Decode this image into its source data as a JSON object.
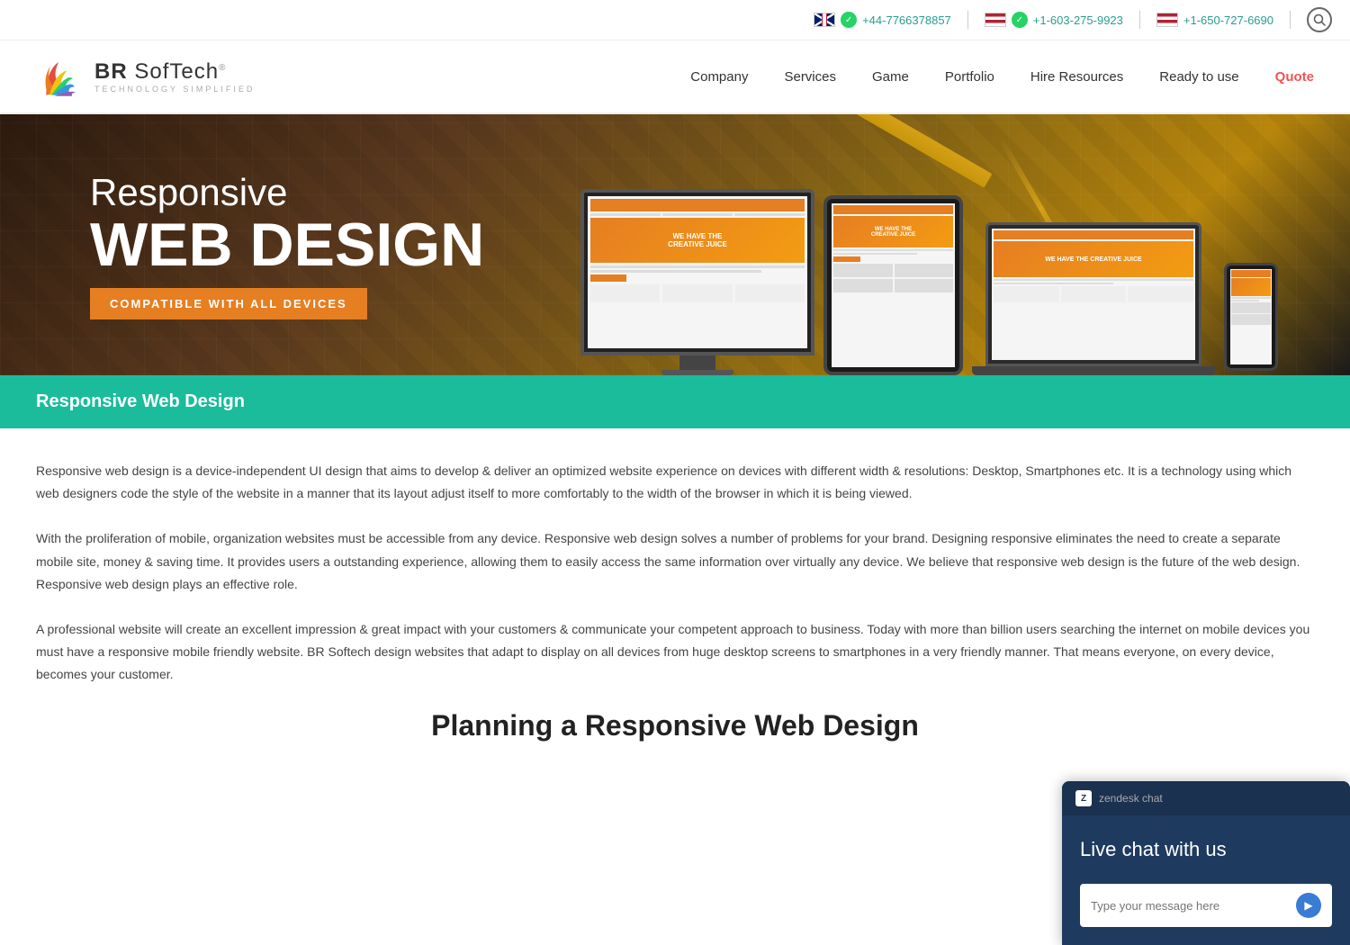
{
  "topbar": {
    "phone_uk": "+44-7766378857",
    "phone_us1": "+1-603-275-9923",
    "phone_us2": "+1-650-727-6690"
  },
  "header": {
    "brand": "BR SofTech",
    "tagline": "TECHNOLOGY SIMPLIFIED",
    "nav": {
      "company": "Company",
      "services": "Services",
      "game": "Game",
      "portfolio": "Portfolio",
      "hire_resources": "Hire Resources",
      "ready_to_use": "Ready to use",
      "quote": "Quote"
    }
  },
  "hero": {
    "line1": "Responsive",
    "line2": "WEB DESIGN",
    "badge": "COMPATIBLE WITH ALL DEVICES"
  },
  "breadcrumb": {
    "title": "Responsive Web Design"
  },
  "content": {
    "para1": "Responsive web design is a device-independent UI design that aims to develop & deliver an optimized website experience on devices with different width & resolutions: Desktop, Smartphones etc. It is a technology using which web designers code the style of the website in a manner that its layout adjust itself to more comfortably to the width of the browser in which it is being viewed.",
    "para2": "With the proliferation of mobile, organization websites must be accessible from any device. Responsive web design solves a number of problems for your brand. Designing responsive eliminates the need to create a separate mobile site, money & saving time. It provides users a outstanding experience, allowing them to easily access the same information over virtually any device. We believe that responsive web design is the future of the web design. Responsive web design plays an effective role.",
    "para3": "A professional website will create an excellent impression & great impact with your customers & communicate your competent approach to business. Today with more than billion users searching the internet on mobile devices you must have a responsive mobile friendly website. BR Softech design websites that adapt to display on all devices from huge desktop screens to smartphones in a very friendly manner. That means everyone, on every device, becomes your customer.",
    "section_heading": "Planning a Responsive Web Design"
  },
  "zendesk": {
    "brand_label": "zendesk chat",
    "chat_text": "Live chat with us",
    "input_placeholder": "Type your message here",
    "send_icon": "▶"
  }
}
